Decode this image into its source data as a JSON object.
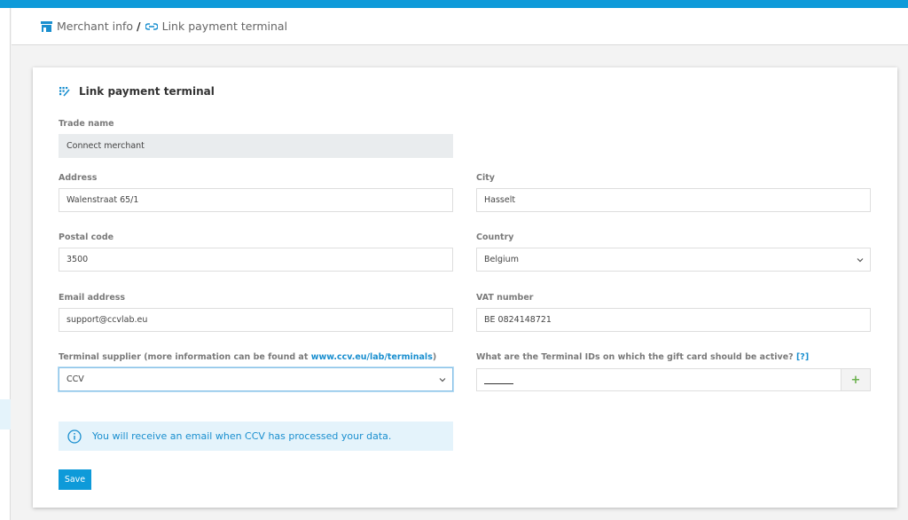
{
  "breadcrumb": {
    "items": [
      "Merchant info",
      "Link payment terminal"
    ],
    "separator": "/"
  },
  "card": {
    "title": "Link payment terminal"
  },
  "form": {
    "trade_name": {
      "label": "Trade name",
      "value": "Connect merchant"
    },
    "address": {
      "label": "Address",
      "value": "Walenstraat 65/1"
    },
    "city": {
      "label": "City",
      "value": "Hasselt"
    },
    "postal_code": {
      "label": "Postal code",
      "value": "3500"
    },
    "country": {
      "label": "Country",
      "value": "Belgium"
    },
    "email": {
      "label": "Email address",
      "value": "support@ccvlab.eu"
    },
    "vat": {
      "label": "VAT number",
      "value": "BE 0824148721"
    },
    "supplier": {
      "label_prefix": "Terminal supplier (more information can be found at ",
      "label_link": "www.ccv.eu/lab/terminals",
      "label_suffix": ")",
      "value": "CCV"
    },
    "terminal_ids": {
      "label": "What are the Terminal IDs on which the gift card should be active?",
      "help_link": "[?]",
      "add_label": "+"
    }
  },
  "info_message": "You will receive an email when CCV has processed your data.",
  "save_label": "Save",
  "colors": {
    "brand": "#0e9ad9",
    "link": "#1a8fcf",
    "info_bg": "#e4f3fb",
    "add_green": "#6ab04c"
  },
  "icons": {
    "merchant": "store-icon",
    "link": "link-icon",
    "terminal": "terminal-grid-icon",
    "info": "info-circle-icon",
    "chevron": "chevron-down-icon"
  }
}
